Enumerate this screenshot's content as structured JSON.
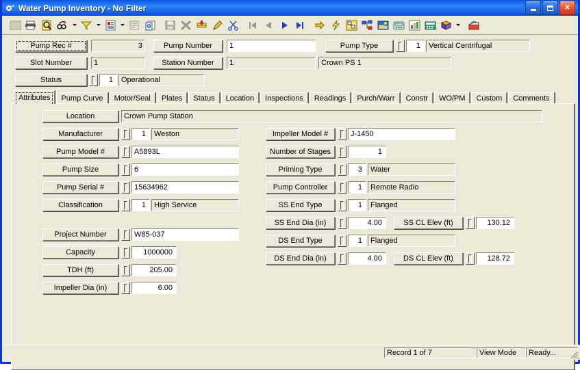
{
  "window": {
    "title": "Water Pump Inventory - No Filter",
    "app_icon": "pump-icon",
    "minimize_label": "Minimize",
    "maximize_label": "Maximize",
    "close_label": "Close",
    "accent_color": "#0a36d4",
    "face_color": "#ece9d8"
  },
  "toolbar": {
    "buttons": [
      {
        "name": "grid-view-icon",
        "tip": "Grid View"
      },
      {
        "name": "print-icon",
        "tip": "Print"
      },
      {
        "name": "print-preview-icon",
        "tip": "Print Preview"
      },
      {
        "name": "find-icon",
        "tip": "Find"
      },
      {
        "name": "find-dropdown-icon",
        "tip": "Find Options"
      },
      {
        "name": "filter-icon",
        "tip": "Filter"
      },
      {
        "name": "filter-dropdown-icon",
        "tip": "Filter Options"
      },
      {
        "name": "report-icon",
        "tip": "Report"
      },
      {
        "name": "report-dropdown-icon",
        "tip": "Report Options"
      },
      {
        "name": "properties-icon",
        "tip": "Properties"
      },
      {
        "name": "copy-record-icon",
        "tip": "Copy Record"
      },
      {
        "name": "save-icon",
        "tip": "Save"
      },
      {
        "name": "delete-icon",
        "tip": "Delete"
      },
      {
        "name": "add-record-icon",
        "tip": "Add Record"
      },
      {
        "name": "edit-icon",
        "tip": "Edit"
      },
      {
        "name": "cut-icon",
        "tip": "Cut"
      },
      {
        "name": "first-record-icon",
        "tip": "First Record"
      },
      {
        "name": "previous-record-icon",
        "tip": "Previous Record"
      },
      {
        "name": "next-record-icon",
        "tip": "Next Record"
      },
      {
        "name": "last-record-icon",
        "tip": "Last Record"
      },
      {
        "name": "goto-icon",
        "tip": "Go To"
      },
      {
        "name": "lightning-icon",
        "tip": "Quick Action"
      },
      {
        "name": "diagram-icon",
        "tip": "Diagram"
      },
      {
        "name": "tree-icon",
        "tip": "Tree View"
      },
      {
        "name": "map-icon",
        "tip": "Map"
      },
      {
        "name": "phone-icon",
        "tip": "Phone"
      },
      {
        "name": "chart-icon",
        "tip": "Chart"
      },
      {
        "name": "calculator-icon",
        "tip": "Calculator"
      },
      {
        "name": "help-book-icon",
        "tip": "Help"
      },
      {
        "name": "help-dropdown-icon",
        "tip": "Help Options"
      },
      {
        "name": "exit-icon",
        "tip": "Exit"
      }
    ]
  },
  "header": {
    "pump_rec": {
      "label": "Pump Rec #",
      "value": "3"
    },
    "slot_number": {
      "label": "Slot Number",
      "value": "1"
    },
    "status": {
      "label": "Status",
      "code": "1",
      "value": "Operational"
    },
    "pump_number": {
      "label": "Pump Number",
      "value": "1"
    },
    "station_number": {
      "label": "Station Number",
      "code": "1",
      "value": "Crown PS 1"
    },
    "pump_type": {
      "label": "Pump Type",
      "code": "1",
      "value": "Vertical Centrifugal"
    }
  },
  "tabs": {
    "active": "Attributes",
    "items": [
      {
        "label": "Attributes"
      },
      {
        "label": "Pump Curve"
      },
      {
        "label": "Motor/Seal"
      },
      {
        "label": "Plates"
      },
      {
        "label": "Status"
      },
      {
        "label": "Location"
      },
      {
        "label": "Inspections"
      },
      {
        "label": "Readings"
      },
      {
        "label": "Purch/Warr"
      },
      {
        "label": "Constr"
      },
      {
        "label": "WO/PM"
      },
      {
        "label": "Custom"
      },
      {
        "label": "Comments"
      }
    ]
  },
  "attributes": {
    "location": {
      "label": "Location",
      "value": "Crown Pump Station"
    },
    "manufacturer": {
      "label": "Manufacturer",
      "code": "1",
      "value": "Weston"
    },
    "pump_model": {
      "label": "Pump Model #",
      "value": "A5893L"
    },
    "pump_size": {
      "label": "Pump Size",
      "value": "6"
    },
    "pump_serial": {
      "label": "Pump Serial #",
      "value": "15634962"
    },
    "classification": {
      "label": "Classification",
      "code": "1",
      "value": "High Service"
    },
    "project_number": {
      "label": "Project Number",
      "value": "W85-037"
    },
    "capacity": {
      "label": "Capacity",
      "value": "1000000"
    },
    "tdh": {
      "label": "TDH (ft)",
      "value": "205.00"
    },
    "impeller_dia": {
      "label": "Impeller Dia (in)",
      "value": "6.00"
    },
    "impeller_model": {
      "label": "Impeller Model #",
      "value": "J-1450"
    },
    "number_of_stages": {
      "label": "Number of Stages",
      "value": "1"
    },
    "priming_type": {
      "label": "Priming Type",
      "code": "3",
      "value": "Water"
    },
    "pump_controller": {
      "label": "Pump Controller",
      "code": "1",
      "value": "Remote Radio"
    },
    "ss_end_type": {
      "label": "SS End Type",
      "code": "1",
      "value": "Flanged"
    },
    "ss_end_dia": {
      "label": "SS End Dia (in)",
      "value": "4.00"
    },
    "ss_cl_elev": {
      "label": "SS CL Elev (ft)",
      "value": "130.12"
    },
    "ds_end_type": {
      "label": "DS End Type",
      "code": "1",
      "value": "Flanged"
    },
    "ds_end_dia": {
      "label": "DS End Dia (in)",
      "value": "4.00"
    },
    "ds_cl_elev": {
      "label": "DS CL Elev (ft)",
      "value": "128.72"
    }
  },
  "statusbar": {
    "record": "Record 1 of 7",
    "mode": "View Mode",
    "state": "Ready..."
  }
}
